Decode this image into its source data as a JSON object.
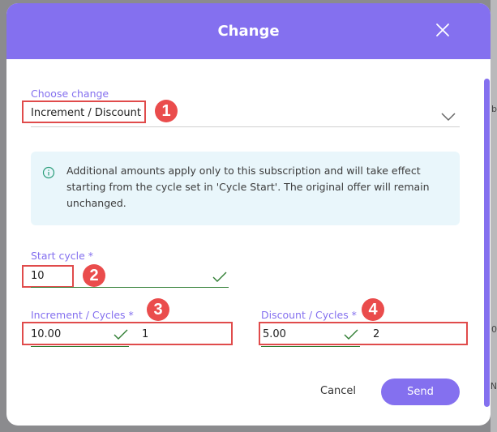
{
  "modal": {
    "title": "Change"
  },
  "change": {
    "label": "Choose change",
    "value": "Increment / Discount"
  },
  "info": {
    "text": "Additional amounts apply only to this subscription and will take effect starting from the cycle set in 'Cycle Start'. The original offer will remain unchanged."
  },
  "start_cycle": {
    "label": "Start cycle *",
    "value": "10"
  },
  "increment": {
    "label": "Increment / Cycles *",
    "amount": "10.00",
    "cycles": "1"
  },
  "discount": {
    "label": "Discount / Cycles *",
    "amount": "5.00",
    "cycles": "2"
  },
  "badges": [
    "1",
    "2",
    "3",
    "4"
  ],
  "actions": {
    "cancel": "Cancel",
    "send": "Send"
  },
  "background": {
    "fragment_1": "b",
    "fragment_2": "0",
    "fragment_3": "N"
  },
  "colors": {
    "accent": "#8470ef",
    "annotation_red": "#e04b4b",
    "valid_green": "#2e7d32",
    "info_bg": "#e9f6fb"
  }
}
